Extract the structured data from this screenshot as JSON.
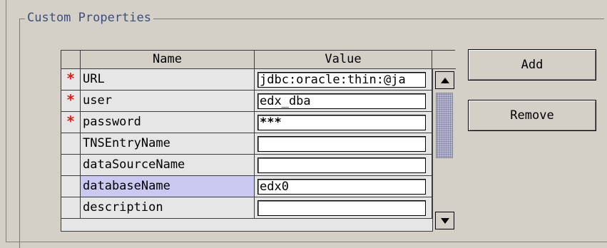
{
  "group": {
    "title": "Custom Properties"
  },
  "table": {
    "columns": [
      "Name",
      "Value"
    ],
    "rows": [
      {
        "required": "*",
        "name": "URL",
        "value": "jdbc:oracle:thin:@ja"
      },
      {
        "required": "*",
        "name": "user",
        "value": "edx_dba"
      },
      {
        "required": "*",
        "name": "password",
        "value": "***"
      },
      {
        "required": "",
        "name": "TNSEntryName",
        "value": ""
      },
      {
        "required": "",
        "name": "dataSourceName",
        "value": ""
      },
      {
        "required": "",
        "name": "databaseName",
        "value": "edx0"
      },
      {
        "required": "",
        "name": "description",
        "value": ""
      }
    ],
    "selected_row": 5
  },
  "buttons": {
    "add": "Add",
    "remove": "Remove"
  },
  "icons": {
    "scroll_up": "arrow-up-icon",
    "scroll_down": "arrow-down-icon"
  },
  "colors": {
    "required_marker": "#e41a1a",
    "selected_row": "#c9c9f2",
    "group_title": "#3d4e78"
  }
}
